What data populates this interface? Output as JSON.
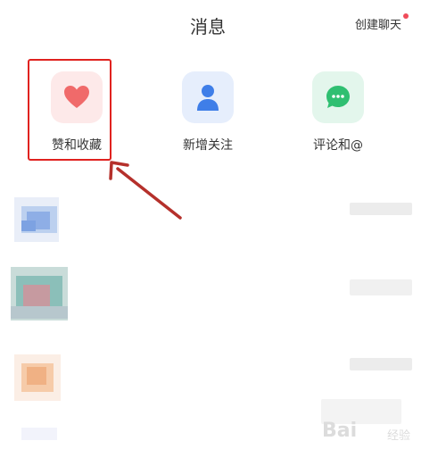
{
  "header": {
    "title": "消息",
    "create_chat": "创建聊天"
  },
  "categories": [
    {
      "label": "赞和收藏",
      "icon": "heart-icon",
      "color": "#f06a6a",
      "bg": "#fde9e9"
    },
    {
      "label": "新增关注",
      "icon": "person-icon",
      "color": "#3f7ee8",
      "bg": "#e6eefc"
    },
    {
      "label": "评论和@",
      "icon": "chat-bubble-icon",
      "color": "#2fbf71",
      "bg": "#e3f6ec"
    }
  ],
  "annotation": {
    "box_color": "#e0221f",
    "arrow_color": "#b5302b"
  },
  "watermark": {
    "logo": "Bai",
    "sub": "经验"
  }
}
